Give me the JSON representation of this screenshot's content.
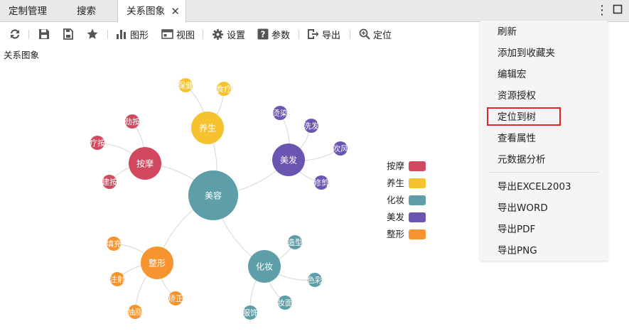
{
  "tabs": [
    {
      "label": "定制管理"
    },
    {
      "label": "搜索"
    },
    {
      "label": "关系图象",
      "close": "✕"
    }
  ],
  "window": {
    "more_icon": "⋮",
    "max_icon": "⬜"
  },
  "toolbar": {
    "refresh_icon": "refresh-icon",
    "save_icon": "save-icon",
    "saveas_icon": "save-as-icon",
    "favorite_icon": "star-icon",
    "chart_label": "图形",
    "view_label": "视图",
    "settings_label": "设置",
    "params_label": "参数",
    "export_label": "导出",
    "locate_label": "定位"
  },
  "content_title": "关系图象",
  "graph": {
    "root": "美容",
    "groups": [
      {
        "name": "按摩",
        "color": "#d2495f",
        "children": [
          "劲按",
          "疗按",
          "建按"
        ]
      },
      {
        "name": "养生",
        "color": "#f6c22d",
        "children": [
          "保健",
          "食疗"
        ]
      },
      {
        "name": "美发",
        "color": "#6a55b1",
        "children": [
          "烫染",
          "洗发",
          "吹风",
          "修剪"
        ]
      },
      {
        "name": "化妆",
        "color": "#5e9ea8",
        "children": [
          "造型",
          "色彩",
          "妆面",
          "服饰"
        ]
      },
      {
        "name": "整形",
        "color": "#f6952e",
        "children": [
          "填充",
          "注射",
          "矫正",
          "抽脂"
        ]
      }
    ],
    "root_color": "#5e9ea8",
    "link_color": "#dddddd"
  },
  "legend": [
    {
      "label": "按摩",
      "color": "#d2495f"
    },
    {
      "label": "养生",
      "color": "#f6c22d"
    },
    {
      "label": "化妆",
      "color": "#5e9ea8"
    },
    {
      "label": "美发",
      "color": "#6a55b1"
    },
    {
      "label": "整形",
      "color": "#f6952e"
    }
  ],
  "menu": {
    "items": [
      "刷新",
      "添加到收藏夹",
      "编辑宏",
      "资源授权",
      "定位到树",
      "查看属性",
      "元数据分析"
    ],
    "export_items": [
      "导出EXCEL2003",
      "导出WORD",
      "导出PDF",
      "导出PNG"
    ],
    "highlighted": "定位到树"
  }
}
